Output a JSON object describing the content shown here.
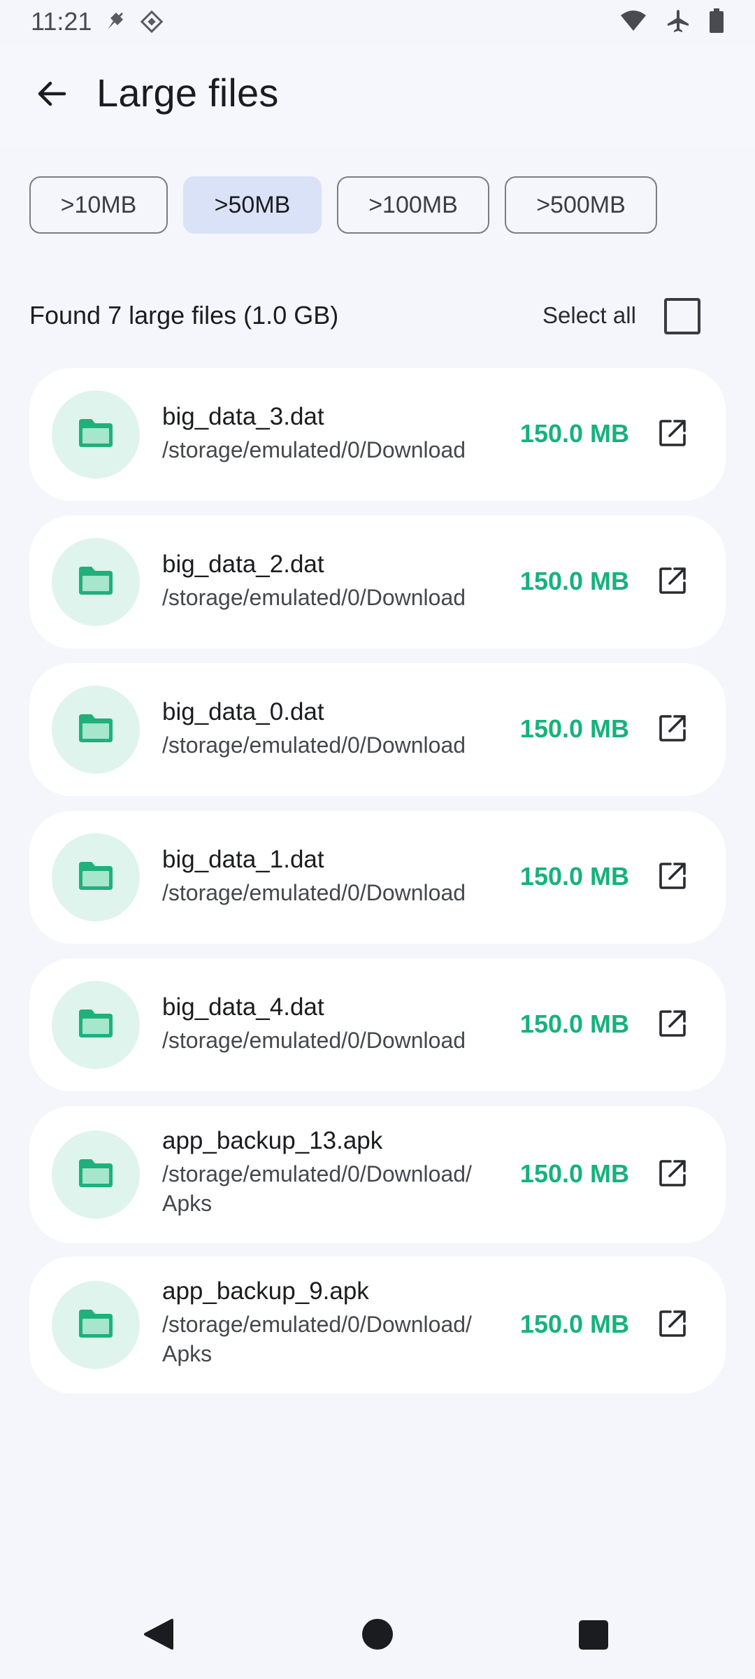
{
  "status_bar": {
    "time": "11:21",
    "left_icons": [
      "notification-pin-icon",
      "system-badge-icon"
    ],
    "right_icons": [
      "wifi-icon",
      "airplane-mode-icon",
      "battery-icon"
    ]
  },
  "header": {
    "title": "Large files",
    "back_icon": "arrow-back-icon"
  },
  "filters": {
    "chips": [
      {
        "label": ">10MB",
        "selected": false
      },
      {
        "label": ">50MB",
        "selected": true
      },
      {
        "label": ">100MB",
        "selected": false
      },
      {
        "label": ">500MB",
        "selected": false
      }
    ]
  },
  "summary": {
    "text": "Found 7 large files (1.0 GB)",
    "select_all_label": "Select all",
    "select_all_checked": false
  },
  "files": [
    {
      "name": "big_data_3.dat",
      "path": "/storage/emulated/0/Download",
      "size": "150.0 MB"
    },
    {
      "name": "big_data_2.dat",
      "path": "/storage/emulated/0/Download",
      "size": "150.0 MB"
    },
    {
      "name": "big_data_0.dat",
      "path": "/storage/emulated/0/Download",
      "size": "150.0 MB"
    },
    {
      "name": "big_data_1.dat",
      "path": "/storage/emulated/0/Download",
      "size": "150.0 MB"
    },
    {
      "name": "big_data_4.dat",
      "path": "/storage/emulated/0/Download",
      "size": "150.0 MB"
    },
    {
      "name": "app_backup_13.apk",
      "path": "/storage/emulated/0/Download/\nApks",
      "size": "150.0 MB"
    },
    {
      "name": "app_backup_9.apk",
      "path": "/storage/emulated/0/Download/\nApks",
      "size": "150.0 MB"
    }
  ],
  "colors": {
    "accent_green": "#16b27c",
    "selected_chip": "#dae2f8",
    "icon_circle": "#dff4ec",
    "folder_icon": "#1fb07c"
  },
  "nav_bar": {
    "icons": [
      "nav-back-icon",
      "nav-home-icon",
      "nav-recents-icon"
    ]
  }
}
